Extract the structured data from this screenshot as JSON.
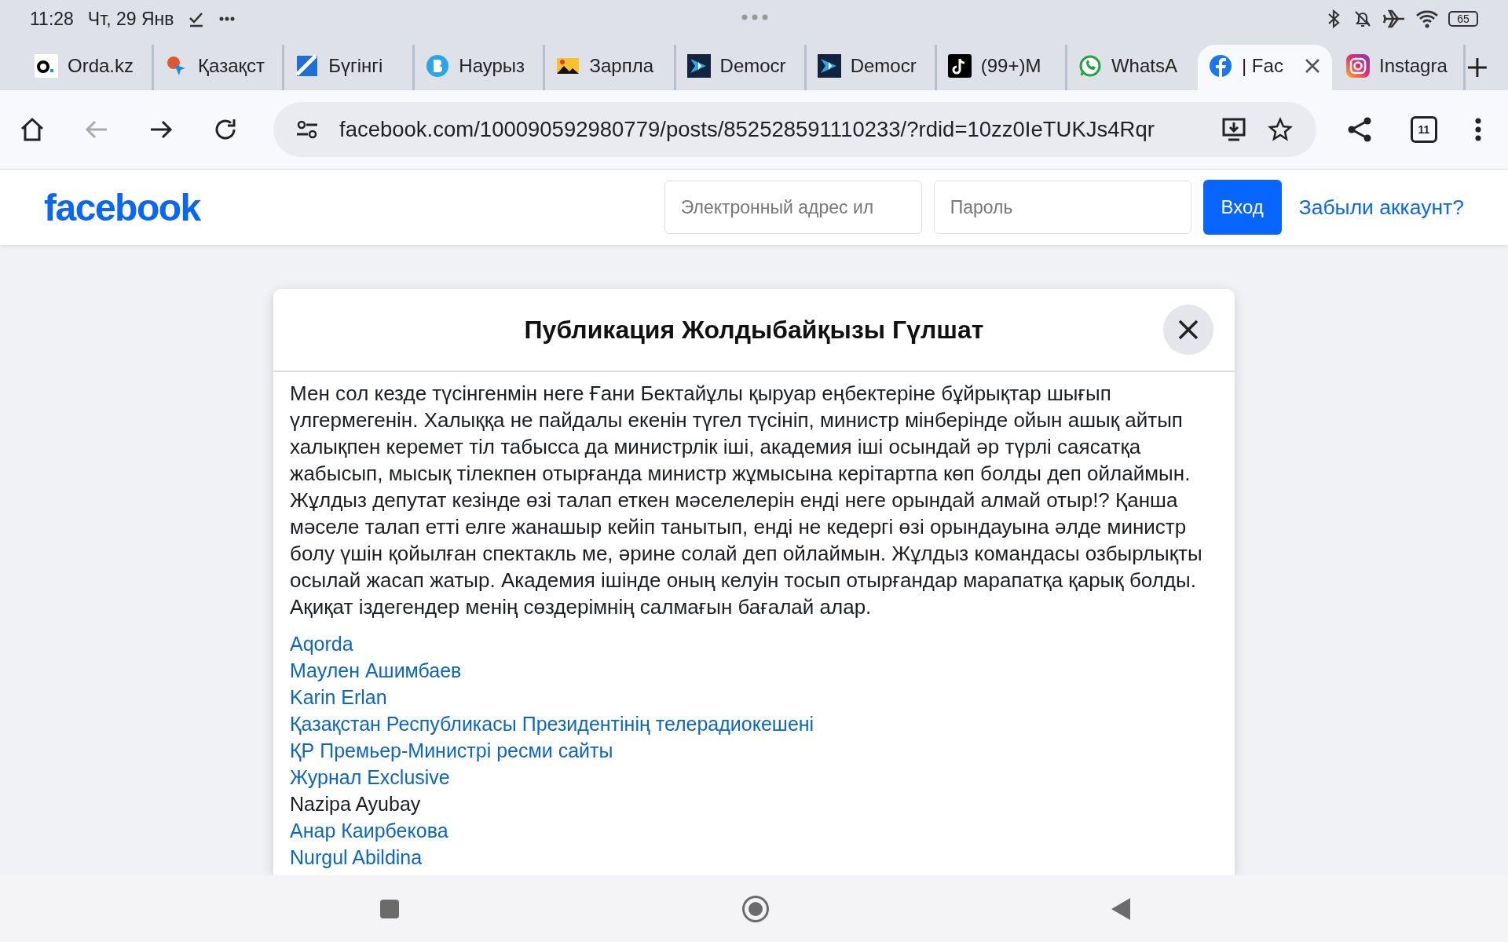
{
  "status_bar": {
    "time": "11:28",
    "date": "Чт, 29 Янв",
    "battery": "65"
  },
  "tabs": [
    {
      "title": "Orda.kz",
      "kind": "orda",
      "selected": false
    },
    {
      "title": "Қазақст",
      "kind": "pin",
      "selected": false
    },
    {
      "title": "Бүгінгі",
      "kind": "stripe",
      "selected": false
    },
    {
      "title": "Наурыз",
      "kind": "letter",
      "selected": false
    },
    {
      "title": "Зарпла",
      "kind": "image",
      "selected": false
    },
    {
      "title": "Democr",
      "kind": "star",
      "selected": false
    },
    {
      "title": "Democr",
      "kind": "star",
      "selected": false
    },
    {
      "title": "(99+)M",
      "kind": "note",
      "selected": false
    },
    {
      "title": "WhatsA",
      "kind": "phone",
      "selected": false
    },
    {
      "title": "| Fac",
      "kind": "fb",
      "selected": true
    },
    {
      "title": "Instagra",
      "kind": "camera",
      "selected": false
    }
  ],
  "toolbar": {
    "back_disabled": true,
    "url": "facebook.com/100090592980779/posts/852528591110233/?rdid=10zz0IeTUKJs4Rqr",
    "tab_count": "11"
  },
  "header": {
    "logo": "facebook",
    "email_placeholder": "Электронный адрес ил",
    "password_placeholder": "Пароль",
    "login_button": "Вход",
    "forgot_link": "Забыли аккаунт?"
  },
  "dialog": {
    "title": "Публикация Жолдыбайқызы Гүлшат",
    "body": "Мен сол кезде түсінгенмін неге Ғани Бектайұлы қыруар еңбектеріне бұйрықтар шығып үлгермегенін. Халыққа не пайдалы екенін түгел түсініп, министр мінберінде ойын ашық айтып халықпен керемет тіл табысса да министрлік іші, академия іші осындай әр түрлі саясатқа жабысып, мысық тілекпен отырғанда министр жұмысына керітартпа көп болды деп ойлаймын. Жұлдыз депутат кезінде өзі талап еткен мәселелерін енді неге орындай алмай отыр!? Қанша мәселе талап етті елге жанашыр кейіп танытып, енді не кедергі өзі орындауына әлде министр болу үшін қойылған спектакль ме, әрине солай деп ойлаймын. Жұлдыз командасы озбырлықты осылай жасап жатыр. Академия ішінде оның келуін тосып отырғандар марапатқа қарық болды. Ақиқат іздегендер менің сөздерімнің салмағын бағалай алар.",
    "tags": [
      {
        "text": "Aqorda",
        "link": true
      },
      {
        "text": "Маулен Ашимбаев",
        "link": true
      },
      {
        "text": "Karin Erlan",
        "link": true
      },
      {
        "text": "Қазақстан Республикасы Президентінің телерадиокешені",
        "link": true
      },
      {
        "text": "ҚР Премьер-Министрі ресми сайты",
        "link": true
      },
      {
        "text": "Журнал Exclusive",
        "link": true
      },
      {
        "text": "Nazipa Ayubay",
        "link": false
      },
      {
        "text": "Анар Каирбекова",
        "link": true
      },
      {
        "text": "Nurgul Abildina",
        "link": true
      }
    ]
  }
}
